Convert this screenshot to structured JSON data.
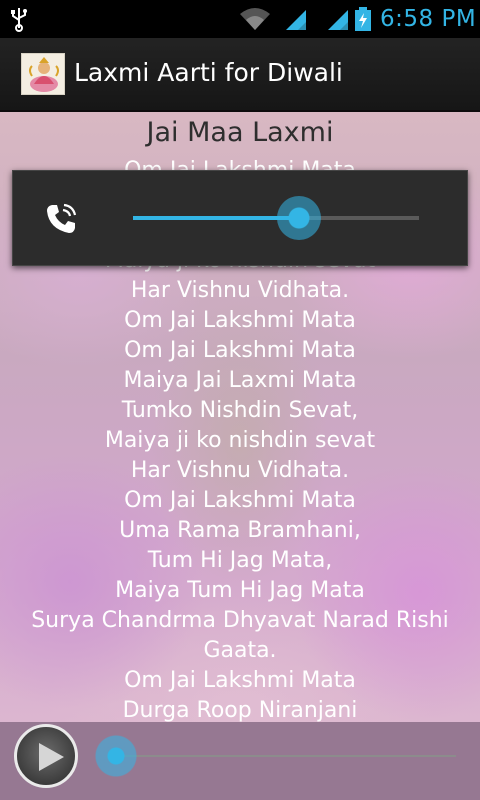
{
  "status_bar": {
    "time": "6:58 PM",
    "icons": [
      "usb-icon",
      "wifi-icon",
      "signal-icon",
      "signal-icon",
      "battery-charging-icon"
    ],
    "accent_color": "#33b5e5"
  },
  "action_bar": {
    "title": "Laxmi Aarti for Diwali",
    "app_icon": "lakshmi-app-icon"
  },
  "lyrics": {
    "title": "Jai Maa Laxmi",
    "lines": [
      "Om Jai Lakshmi Mata",
      "Maiya ji ko nishdin sevat",
      "Har Vishnu Vidhata.",
      "Om Jai Lakshmi Mata",
      "Om Jai Lakshmi Mata",
      "Maiya Jai Laxmi Mata",
      "Tumko Nishdin Sevat,",
      "Maiya ji ko nishdin sevat",
      "Har Vishnu Vidhata.",
      "Om Jai Lakshmi Mata",
      "Uma Rama Bramhani,",
      "Tum Hi Jag Mata,",
      "Maiya Tum Hi Jag Mata",
      "Surya Chandrma Dhyavat Narad Rishi",
      "Gaata.",
      "Om Jai Lakshmi Mata",
      "Durga Roop Niranjani"
    ]
  },
  "volume_dialog": {
    "stream_icon": "phone-call-icon",
    "level": 0.58
  },
  "player": {
    "play_icon": "play-icon",
    "progress": 0.0
  }
}
